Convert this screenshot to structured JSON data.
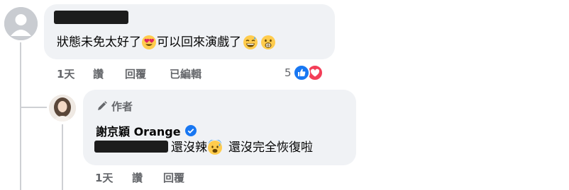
{
  "comment1": {
    "text_part1": "狀態未免太好了",
    "text_part2": "可以回來演戲了",
    "reaction_count": "5",
    "actions": {
      "time": "1天",
      "like": "讚",
      "reply": "回覆",
      "edited": "已編輯"
    }
  },
  "reply1": {
    "author_badge": "作者",
    "author_name": "謝京穎 Orange",
    "text_part1": "還沒辣",
    "text_part2": "還沒完全恢復啦",
    "actions": {
      "time": "1天",
      "like": "讚",
      "reply": "回覆"
    }
  },
  "colors": {
    "bubble": "#f0f2f5",
    "like_blue": "#1877f2",
    "love_red": "#f33e58",
    "muted_text": "#65676b"
  }
}
